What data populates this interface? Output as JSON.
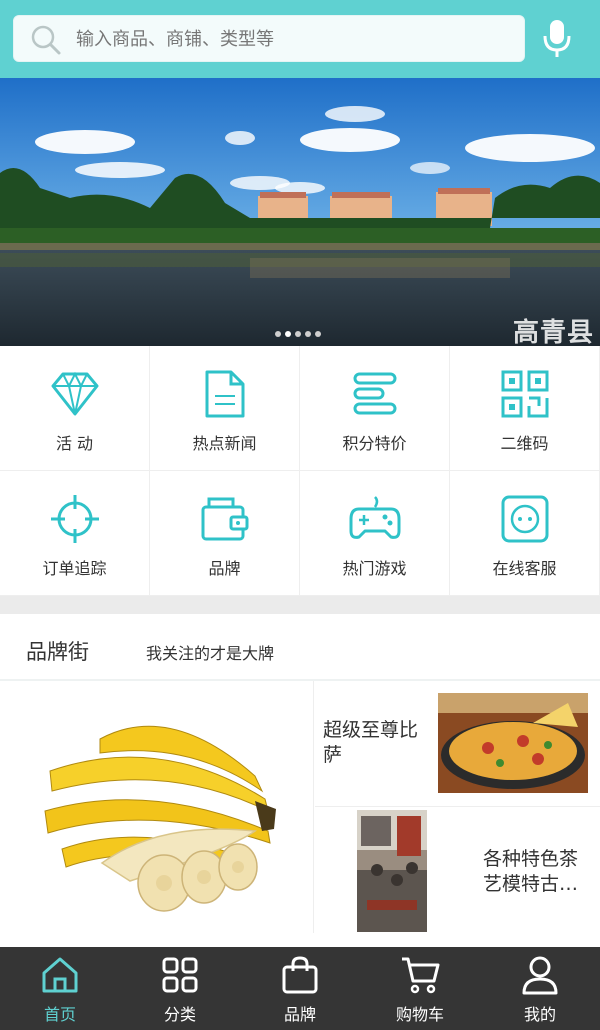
{
  "search": {
    "placeholder": "输入商品、商铺、类型等"
  },
  "banner": {
    "watermark": "高青县",
    "slide_count": 5,
    "active_slide": 2
  },
  "grid": [
    {
      "label": "活 动",
      "icon": "diamond-icon"
    },
    {
      "label": "热点新闻",
      "icon": "document-icon"
    },
    {
      "label": "积分特价",
      "icon": "list-icon"
    },
    {
      "label": "二维码",
      "icon": "qr-code-icon"
    },
    {
      "label": "订单追踪",
      "icon": "crosshair-icon"
    },
    {
      "label": "品牌",
      "icon": "wallet-icon"
    },
    {
      "label": "热门游戏",
      "icon": "gamepad-icon"
    },
    {
      "label": "在线客服",
      "icon": "socket-icon"
    }
  ],
  "brand": {
    "title": "品牌街",
    "subtitle": "我关注的才是大牌",
    "cards": [
      {
        "text": "超级至尊比萨"
      },
      {
        "text": "各种特色茶艺模特古…"
      }
    ]
  },
  "nav": [
    {
      "label": "首页",
      "icon": "home-icon",
      "active": true
    },
    {
      "label": "分类",
      "icon": "grid-icon",
      "active": false
    },
    {
      "label": "品牌",
      "icon": "bag-icon",
      "active": false
    },
    {
      "label": "购物车",
      "icon": "cart-icon",
      "active": false
    },
    {
      "label": "我的",
      "icon": "user-icon",
      "active": false
    }
  ],
  "colors": {
    "accent": "#5fd1d1",
    "nav_bg": "#353535"
  }
}
